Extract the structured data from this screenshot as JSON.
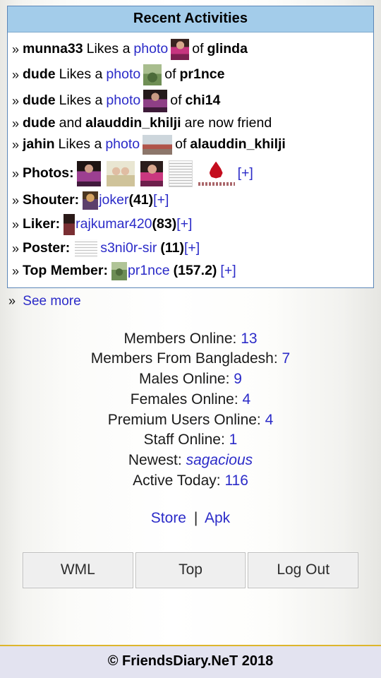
{
  "panel": {
    "title": "Recent Activities",
    "activities": [
      {
        "bullet": "»",
        "user": "munna33",
        "verb": "Likes a",
        "link": "photo",
        "thumb": "photo-thumb-glinda",
        "mid": "of",
        "target": "glinda"
      },
      {
        "bullet": "»",
        "user": "dude",
        "verb": "Likes a",
        "link": "photo",
        "thumb": "photo-thumb-pr1nce",
        "mid": "of",
        "target": "pr1nce"
      },
      {
        "bullet": "»",
        "user": "dude",
        "verb": "Likes a",
        "link": "photo",
        "thumb": "photo-thumb-chi14",
        "mid": "of",
        "target": "chi14"
      },
      {
        "bullet": "»",
        "user": "dude",
        "verb": "and",
        "link": "",
        "thumb": "",
        "mid": "alauddin_khilji",
        "target": "are now friend"
      },
      {
        "bullet": "»",
        "user": "jahin",
        "verb": "Likes a",
        "link": "photo",
        "thumb": "photo-thumb-alauddin",
        "mid": "of",
        "target": "alauddin_khilji"
      }
    ],
    "rows": {
      "photos": {
        "bullet": "»",
        "label": "Photos:",
        "plus": "[+]"
      },
      "shouter": {
        "bullet": "»",
        "label": "Shouter:",
        "name": "joker",
        "count": "(41)",
        "plus": "[+]"
      },
      "liker": {
        "bullet": "»",
        "label": "Liker:",
        "name": "rajkumar420",
        "count": "(83)",
        "plus": "[+]"
      },
      "poster": {
        "bullet": "»",
        "label": "Poster:",
        "name": "s3ni0r-sir",
        "count": "(11)",
        "plus": "[+]"
      },
      "top_member": {
        "bullet": "»",
        "label": "Top Member:",
        "name": "pr1nce",
        "count": "(157.2)",
        "plus": "[+]"
      }
    }
  },
  "see_more": {
    "bullet": "»",
    "label": "See more"
  },
  "stats": [
    {
      "label": "Members Online:",
      "value": "13",
      "italic": false
    },
    {
      "label": "Members From Bangladesh:",
      "value": "7",
      "italic": false
    },
    {
      "label": "Males Online:",
      "value": "9",
      "italic": false
    },
    {
      "label": "Females Online:",
      "value": "4",
      "italic": false
    },
    {
      "label": "Premium Users Online:",
      "value": "4",
      "italic": false
    },
    {
      "label": "Staff Online:",
      "value": "1",
      "italic": false
    },
    {
      "label": "Newest:",
      "value": "sagacious",
      "italic": true
    },
    {
      "label": "Active Today:",
      "value": "116",
      "italic": false
    }
  ],
  "storebar": {
    "store": "Store",
    "divider": "|",
    "apk": "Apk"
  },
  "buttons": {
    "wml": "WML",
    "top": "Top",
    "logout": "Log Out"
  },
  "footer": {
    "text": "© FriendsDiary.NeT 2018"
  },
  "colors": {
    "header_bg": "#a3ccea",
    "panel_border": "#5b86b8",
    "link": "#2b2bc8",
    "footer_bg": "#e3e3f0",
    "footer_border": "#ddb62c",
    "button_bg": "#efefef"
  }
}
